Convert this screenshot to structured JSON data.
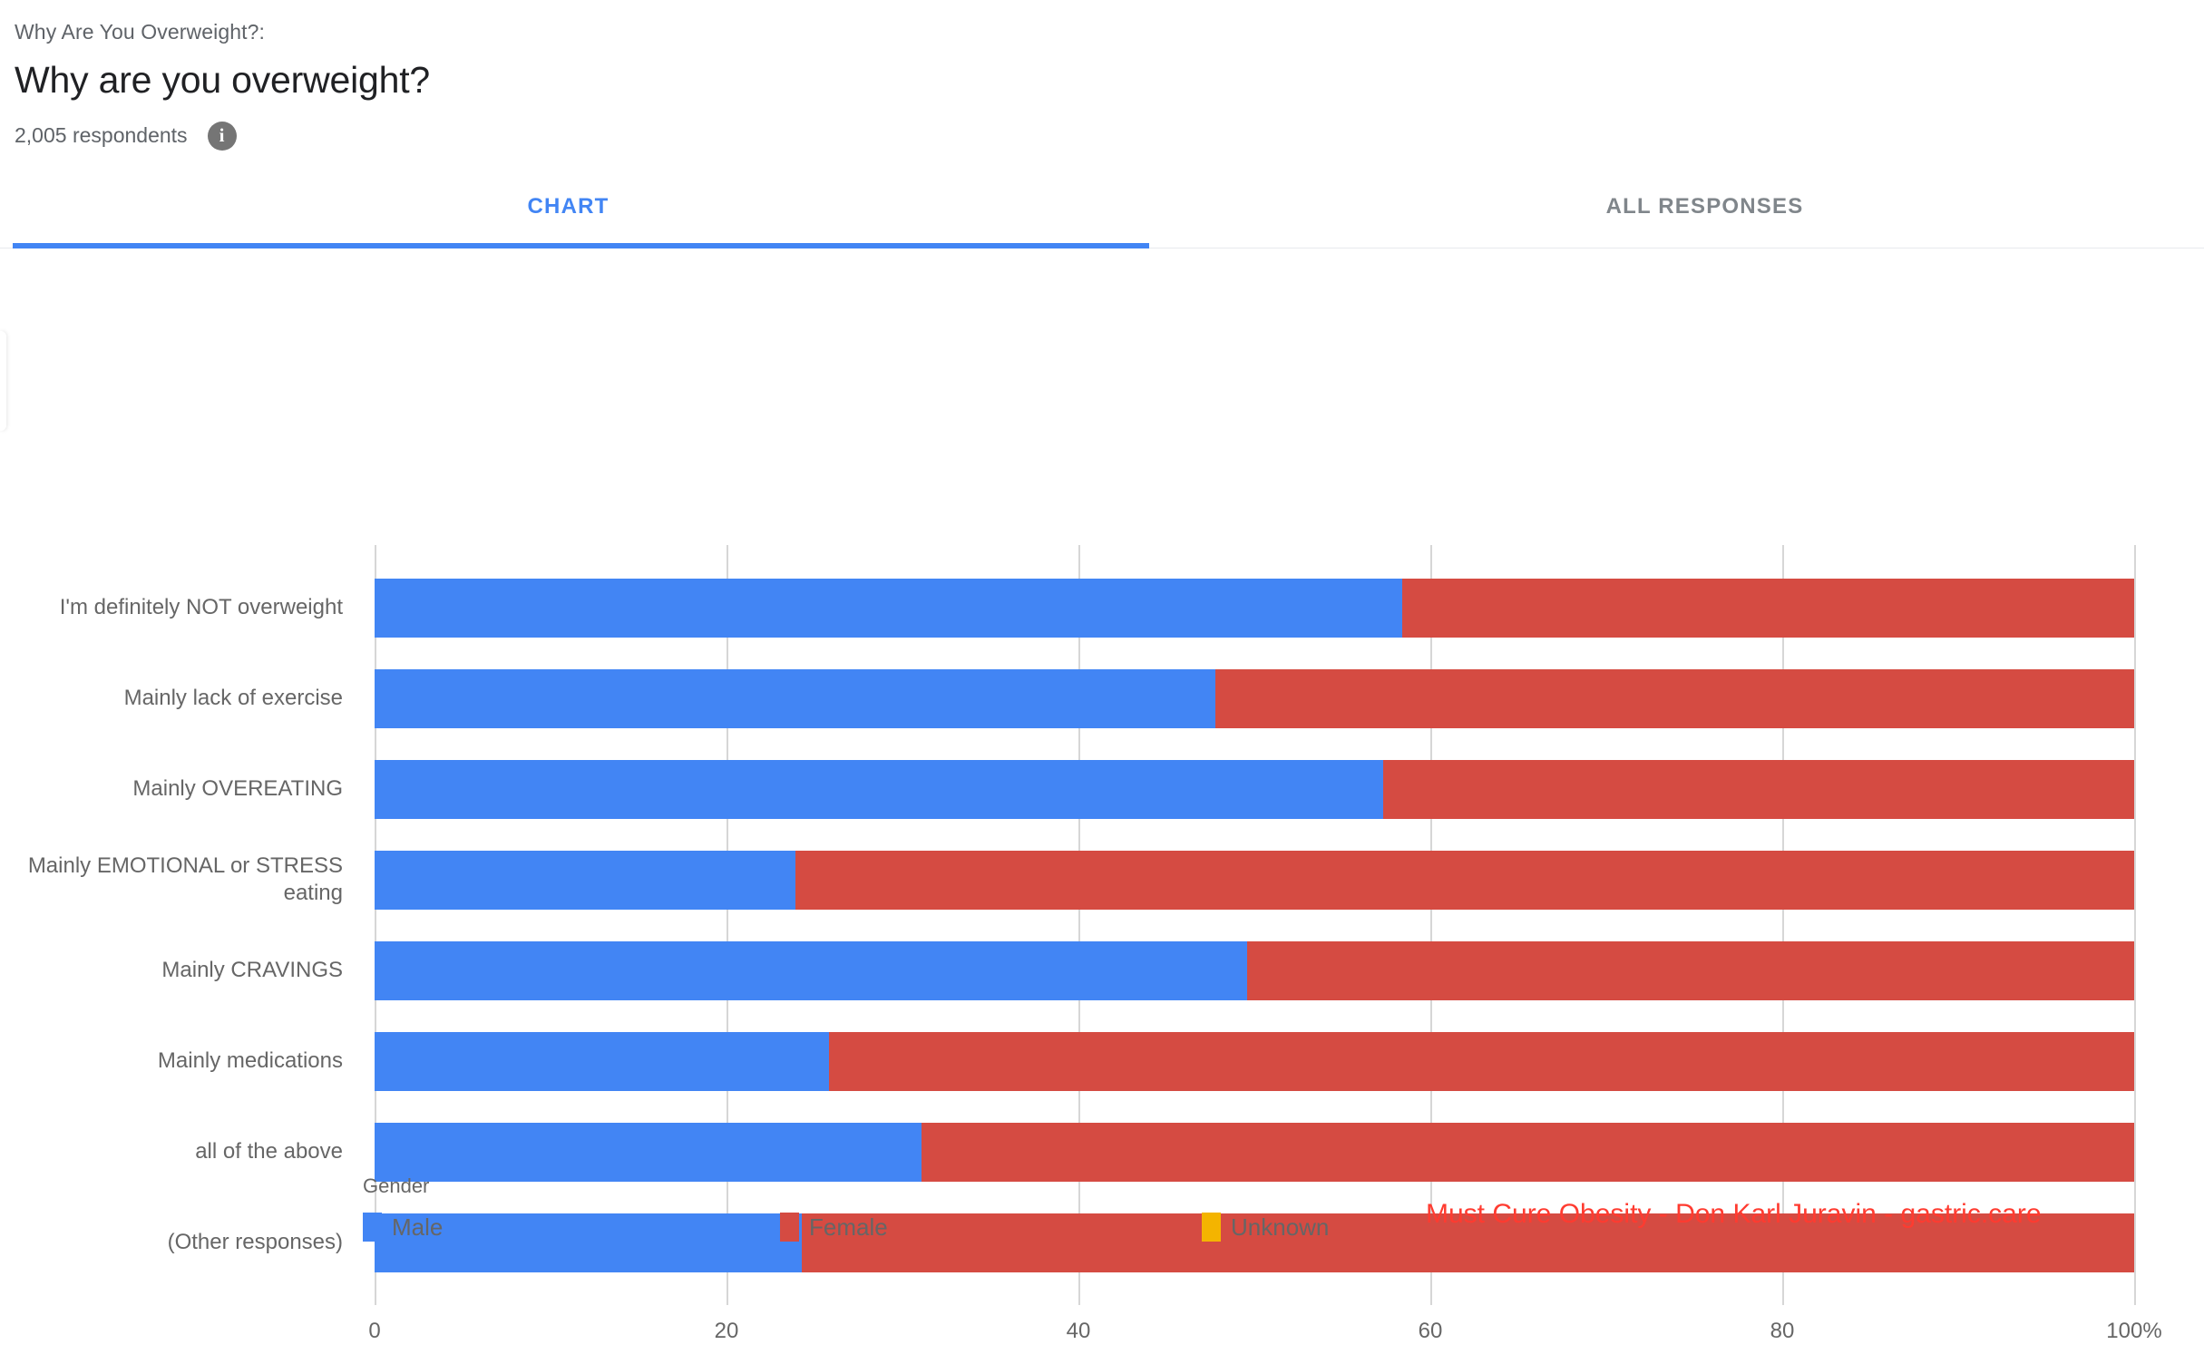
{
  "header": {
    "eyebrow": "Why Are You Overweight?:",
    "title": "Why are you overweight?",
    "respondents": "2,005 respondents",
    "info_icon": "info-icon",
    "info_glyph": "i"
  },
  "tabs": [
    {
      "label": "CHART",
      "active": true
    },
    {
      "label": "ALL RESPONSES",
      "active": false
    }
  ],
  "legend": {
    "title": "Gender",
    "items": [
      {
        "label": "Male",
        "color": "#4285f4"
      },
      {
        "label": "Female",
        "color": "#d54b42"
      },
      {
        "label": "Unknown",
        "color": "#f4b400"
      }
    ]
  },
  "watermark": "Must Cure Obesity - Don Karl Juravin - gastric.care",
  "colors": {
    "accent": "#4285f4",
    "male": "#4285f4",
    "female": "#d54b42",
    "unknown": "#f4b400",
    "watermark": "#ff3b30",
    "axis_text": "#666666",
    "gridline": "#d6d6d6"
  },
  "chart_data": {
    "type": "bar",
    "orientation": "horizontal",
    "stacked": true,
    "normalized": "100%",
    "title": "Why are you overweight?",
    "xlabel": "",
    "ylabel": "",
    "xlim": [
      0,
      100
    ],
    "xticks": [
      0,
      20,
      40,
      60,
      80,
      100
    ],
    "xtick_labels": [
      "0",
      "20",
      "40",
      "60",
      "80",
      "100%"
    ],
    "grid": true,
    "legend_position": "bottom-left",
    "legend_title": "Gender",
    "categories": [
      "I'm definitely NOT overweight",
      "Mainly lack of exercise",
      "Mainly OVEREATING",
      "Mainly EMOTIONAL or STRESS eating",
      "Mainly CRAVINGS",
      "Mainly medications",
      "all of the above",
      "(Other responses)"
    ],
    "series": [
      {
        "name": "Male",
        "color": "#4285f4",
        "values": [
          58.4,
          47.8,
          57.3,
          23.9,
          49.6,
          25.8,
          31.1,
          24.3
        ]
      },
      {
        "name": "Female",
        "color": "#d54b42",
        "values": [
          41.6,
          52.2,
          42.7,
          76.1,
          50.4,
          74.2,
          68.9,
          75.7
        ]
      },
      {
        "name": "Unknown",
        "color": "#f4b400",
        "values": [
          0,
          0,
          0,
          0,
          0,
          0,
          0,
          0
        ]
      }
    ]
  }
}
